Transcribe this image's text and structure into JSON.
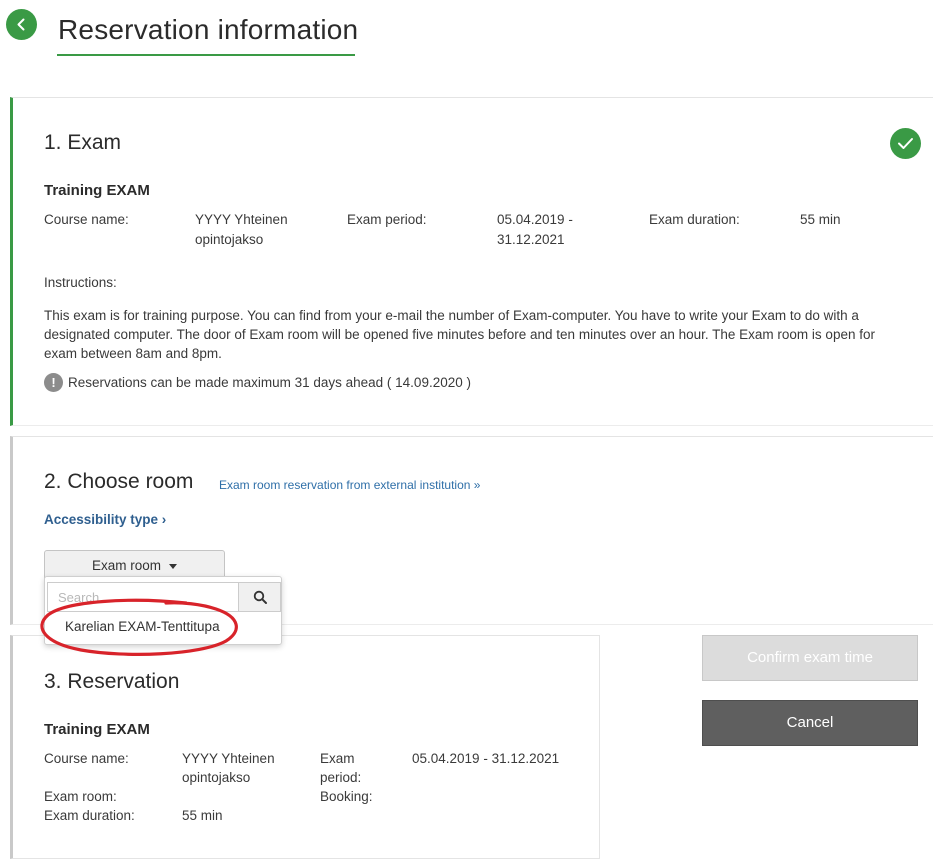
{
  "header": {
    "title": "Reservation information"
  },
  "exam_section": {
    "heading": "1. Exam",
    "exam_name": "Training EXAM",
    "course_name_label": "Course name:",
    "course_name_line1": "YYYY Yhteinen",
    "course_name_line2": "opintojakso",
    "exam_period_label": "Exam period:",
    "exam_period_line1": "05.04.2019 -",
    "exam_period_line2": "31.12.2021",
    "exam_duration_label": "Exam duration:",
    "exam_duration_value": "55 min",
    "instructions_label": "Instructions:",
    "instructions_line1": "This exam is for training purpose. You can find from your e-mail the number of Exam-computer. You have to write your Exam to do with a",
    "instructions_line2": "designated computer. The door of Exam room will be opened five minutes before and ten minutes over an hour. The Exam room is open for",
    "instructions_line3": "exam between 8am and 8pm.",
    "notice_icon": "!",
    "notice": "Reservations can be made maximum 31 days ahead ( 14.09.2020 )"
  },
  "room_section": {
    "heading": "2. Choose room",
    "external_link": "Exam room reservation from external institution »",
    "accessibility_link": "Accessibility type ›",
    "room_dropdown_label": "Exam room",
    "search_placeholder": "Search",
    "room_options": [
      "Karelian EXAM-Tenttitupa"
    ]
  },
  "reservation_section": {
    "heading": "3. Reservation",
    "exam_name": "Training EXAM",
    "course_name_label": "Course name:",
    "course_name_line1": "YYYY Yhteinen",
    "course_name_line2": "opintojakso",
    "exam_period_label_line1": "Exam",
    "exam_period_label_line2": "period:",
    "exam_period_value": "05.04.2019 - 31.12.2021",
    "exam_room_label": "Exam room:",
    "booking_label": "Booking:",
    "exam_duration_label": "Exam duration:",
    "exam_duration_value": "55 min"
  },
  "actions": {
    "confirm_label": "Confirm exam time",
    "cancel_label": "Cancel"
  },
  "colors": {
    "accent_green": "#3a9a45",
    "link_blue": "#2f6fa8",
    "annotation_red": "#d8232a",
    "cancel_gray": "#5f5f5f",
    "disabled_gray": "#dcdcdc"
  }
}
